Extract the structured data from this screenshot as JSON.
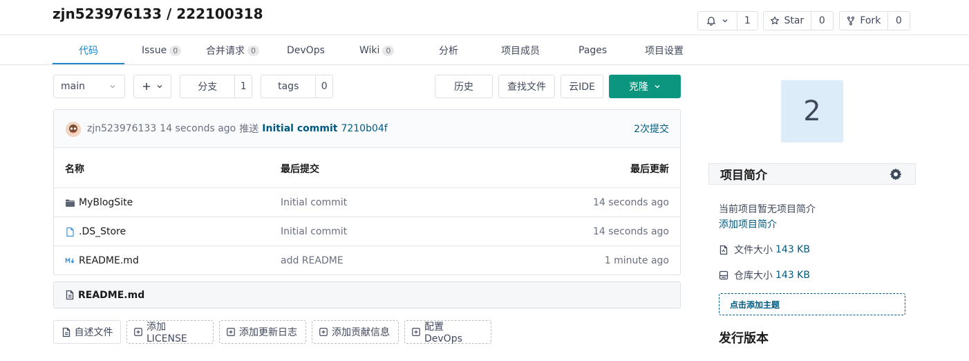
{
  "repo": {
    "owner": "zjn523976133",
    "separator": "/",
    "name": "222100318"
  },
  "actions": {
    "watch_count": "1",
    "star_label": "Star",
    "star_count": "0",
    "fork_label": "Fork",
    "fork_count": "0"
  },
  "tabs": [
    {
      "label": "代码",
      "badge": ""
    },
    {
      "label": "Issue",
      "badge": "0"
    },
    {
      "label": "合并请求",
      "badge": "0"
    },
    {
      "label": "DevOps",
      "badge": ""
    },
    {
      "label": "Wiki",
      "badge": "0"
    },
    {
      "label": "分析",
      "badge": ""
    },
    {
      "label": "项目成员",
      "badge": ""
    },
    {
      "label": "Pages",
      "badge": ""
    },
    {
      "label": "项目设置",
      "badge": ""
    }
  ],
  "toolbar": {
    "branch": "main",
    "branches_label": "分支",
    "branches_count": "1",
    "tags_label": "tags",
    "tags_count": "0",
    "history": "历史",
    "find_file": "查找文件",
    "web_ide": "云IDE",
    "clone": "克隆"
  },
  "commit": {
    "author": "zjn523976133",
    "time": "14 seconds ago",
    "action": "推送",
    "message": "Initial commit",
    "sha": "7210b04f",
    "count_link": "2次提交"
  },
  "table": {
    "headers": {
      "name": "名称",
      "last_commit": "最后提交",
      "last_update": "最后更新"
    },
    "rows": [
      {
        "type": "folder",
        "name": "MyBlogSite",
        "commit": "Initial commit",
        "updated": "14 seconds ago"
      },
      {
        "type": "file",
        "name": ".DS_Store",
        "commit": "Initial commit",
        "updated": "14 seconds ago"
      },
      {
        "type": "markdown",
        "name": "README.md",
        "commit": "add README",
        "updated": "1 minute ago"
      }
    ]
  },
  "readme": {
    "title": "README.md"
  },
  "bottom_actions": {
    "readme": "自述文件",
    "license": "添加LICENSE",
    "changelog": "添加更新日志",
    "contributing": "添加贡献信息",
    "devops": "配置 DevOps"
  },
  "sidebar": {
    "avatar_text": "2",
    "intro_title": "项目简介",
    "intro_empty": "当前项目暂无项目简介",
    "intro_add": "添加项目简介",
    "file_size_label": "文件大小",
    "file_size_value": "143 KB",
    "repo_size_label": "仓库大小",
    "repo_size_value": "143 KB",
    "add_topic": "点击添加主题",
    "releases_title": "发行版本"
  },
  "colors": {
    "accent": "#0c9680",
    "link": "#005980",
    "tab_active": "#1e86c9"
  }
}
